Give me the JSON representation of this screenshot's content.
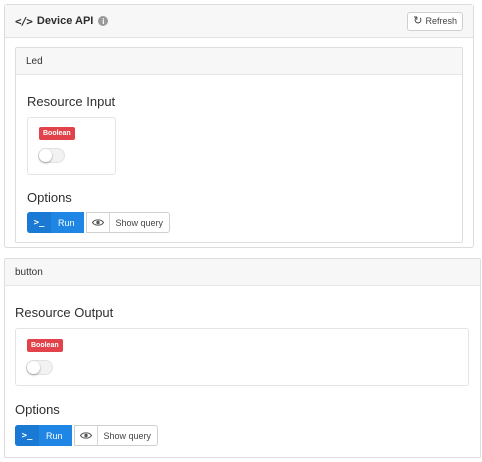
{
  "device_api": {
    "title": "Device API",
    "code_icon_glyph": "</>",
    "info_icon_glyph": "i",
    "refresh_label": "Refresh",
    "refresh_icon_glyph": "↻"
  },
  "panels": [
    {
      "header": "Led",
      "resource_title": "Resource Input",
      "badge": "Boolean",
      "toggle_on": false,
      "options_title": "Options",
      "run_icon_glyph": ">_",
      "run_label": "Run",
      "show_query_label": "Show query"
    },
    {
      "header": "button",
      "resource_title": "Resource Output",
      "badge": "Boolean",
      "toggle_on": false,
      "options_title": "Options",
      "run_icon_glyph": ">_",
      "run_label": "Run",
      "show_query_label": "Show query"
    }
  ],
  "colors": {
    "badge": "#e2434a",
    "run_button": "#1f86e5",
    "header_bg": "#f7f7f7"
  },
  "icons": {
    "code": "code-icon",
    "info": "info-icon",
    "refresh": "refresh-icon",
    "terminal": "terminal-icon",
    "eye": "eye-icon"
  }
}
